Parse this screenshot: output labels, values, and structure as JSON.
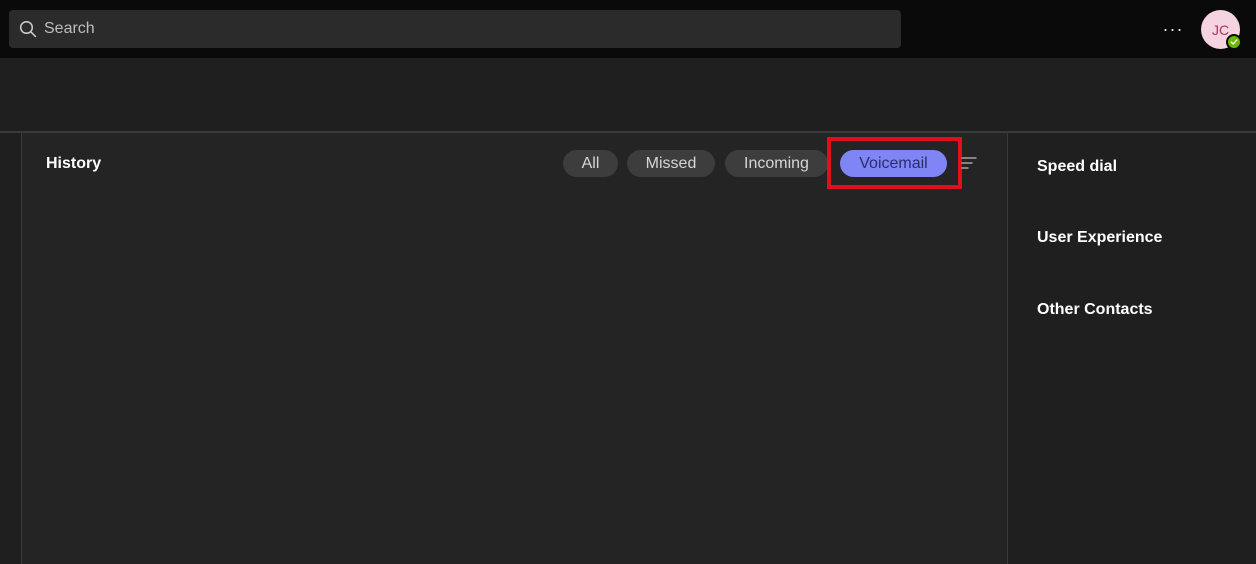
{
  "search": {
    "placeholder": "Search"
  },
  "header": {
    "more_label": "···",
    "avatar_initials": "JC",
    "presence_status": "available",
    "presence_color": "#6bb700"
  },
  "history": {
    "title": "History",
    "filters": [
      {
        "label": "All",
        "active": false
      },
      {
        "label": "Missed",
        "active": false
      },
      {
        "label": "Incoming",
        "active": false
      },
      {
        "label": "Voicemail",
        "active": true
      }
    ],
    "accent_color": "#7f85f5"
  },
  "right_panel": {
    "items": [
      {
        "label": "Speed dial"
      },
      {
        "label": "User Experience"
      },
      {
        "label": "Other Contacts"
      }
    ]
  },
  "icons": {
    "search": "search-icon",
    "more": "more-options-icon",
    "filter": "filter-lines-icon",
    "presence": "check-icon"
  }
}
